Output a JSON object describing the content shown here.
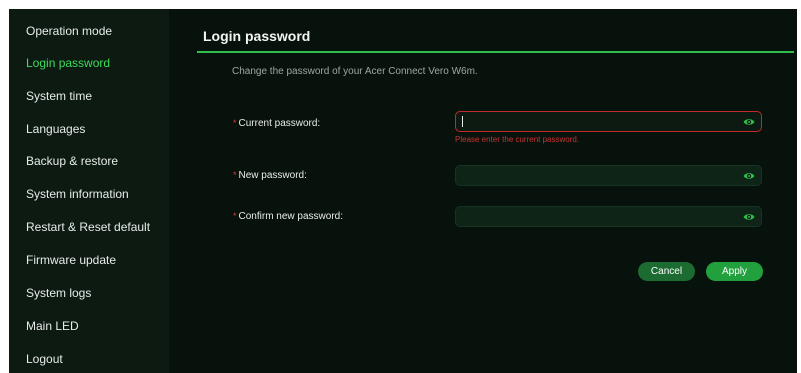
{
  "sidebar": {
    "items": [
      {
        "label": "Operation mode"
      },
      {
        "label": "Login password",
        "active": true
      },
      {
        "label": "System time"
      },
      {
        "label": "Languages"
      },
      {
        "label": "Backup & restore"
      },
      {
        "label": "System information"
      },
      {
        "label": "Restart & Reset default"
      },
      {
        "label": "Firmware update"
      },
      {
        "label": "System logs"
      },
      {
        "label": "Main LED"
      },
      {
        "label": "Logout"
      }
    ]
  },
  "main": {
    "title": "Login password",
    "subtitle": "Change the password of your Acer Connect Vero W6m.",
    "required_mark": "*",
    "fields": [
      {
        "label": "Current password:",
        "value": "",
        "error": "Please enter the current password.",
        "icon": "eye-icon"
      },
      {
        "label": "New password:",
        "value": "",
        "icon": "eye-icon"
      },
      {
        "label": "Confirm new password:",
        "value": "",
        "icon": "eye-icon"
      }
    ],
    "buttons": {
      "cancel": "Cancel",
      "apply": "Apply"
    }
  },
  "colors": {
    "accent": "#2fbf4a",
    "active_nav": "#3ddc5c",
    "error": "#c83232",
    "background": "#08120c",
    "sidebar": "#0d1a12"
  }
}
